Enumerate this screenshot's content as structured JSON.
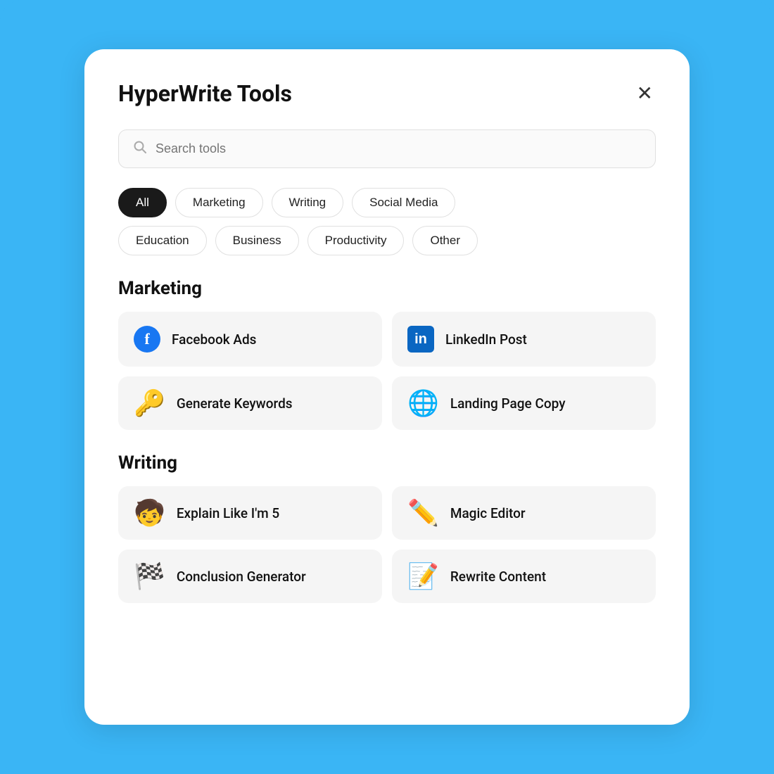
{
  "modal": {
    "title": "HyperWrite Tools",
    "close_label": "×"
  },
  "search": {
    "placeholder": "Search tools"
  },
  "filters": [
    {
      "id": "all",
      "label": "All",
      "active": true
    },
    {
      "id": "marketing",
      "label": "Marketing",
      "active": false
    },
    {
      "id": "writing",
      "label": "Writing",
      "active": false
    },
    {
      "id": "social-media",
      "label": "Social Media",
      "active": false
    },
    {
      "id": "education",
      "label": "Education",
      "active": false
    },
    {
      "id": "business",
      "label": "Business",
      "active": false
    },
    {
      "id": "productivity",
      "label": "Productivity",
      "active": false
    },
    {
      "id": "other",
      "label": "Other",
      "active": false
    }
  ],
  "sections": [
    {
      "id": "marketing",
      "title": "Marketing",
      "tools": [
        {
          "id": "facebook-ads",
          "label": "Facebook Ads",
          "icon": "facebook",
          "emoji": ""
        },
        {
          "id": "linkedin-post",
          "label": "LinkedIn Post",
          "icon": "linkedin",
          "emoji": ""
        },
        {
          "id": "generate-keywords",
          "label": "Generate Keywords",
          "icon": "emoji",
          "emoji": "🔑"
        },
        {
          "id": "landing-page-copy",
          "label": "Landing Page Copy",
          "icon": "emoji",
          "emoji": "🌐"
        }
      ]
    },
    {
      "id": "writing",
      "title": "Writing",
      "tools": [
        {
          "id": "explain-like-im-5",
          "label": "Explain Like I'm 5",
          "icon": "emoji",
          "emoji": "🧒"
        },
        {
          "id": "magic-editor",
          "label": "Magic Editor",
          "icon": "emoji",
          "emoji": "✏️"
        },
        {
          "id": "conclusion-generator",
          "label": "Conclusion Generator",
          "icon": "emoji",
          "emoji": "🏁"
        },
        {
          "id": "rewrite-content",
          "label": "Rewrite Content",
          "icon": "emoji",
          "emoji": "📝"
        }
      ]
    }
  ],
  "icons": {
    "search": "🔍",
    "close": "✕"
  }
}
